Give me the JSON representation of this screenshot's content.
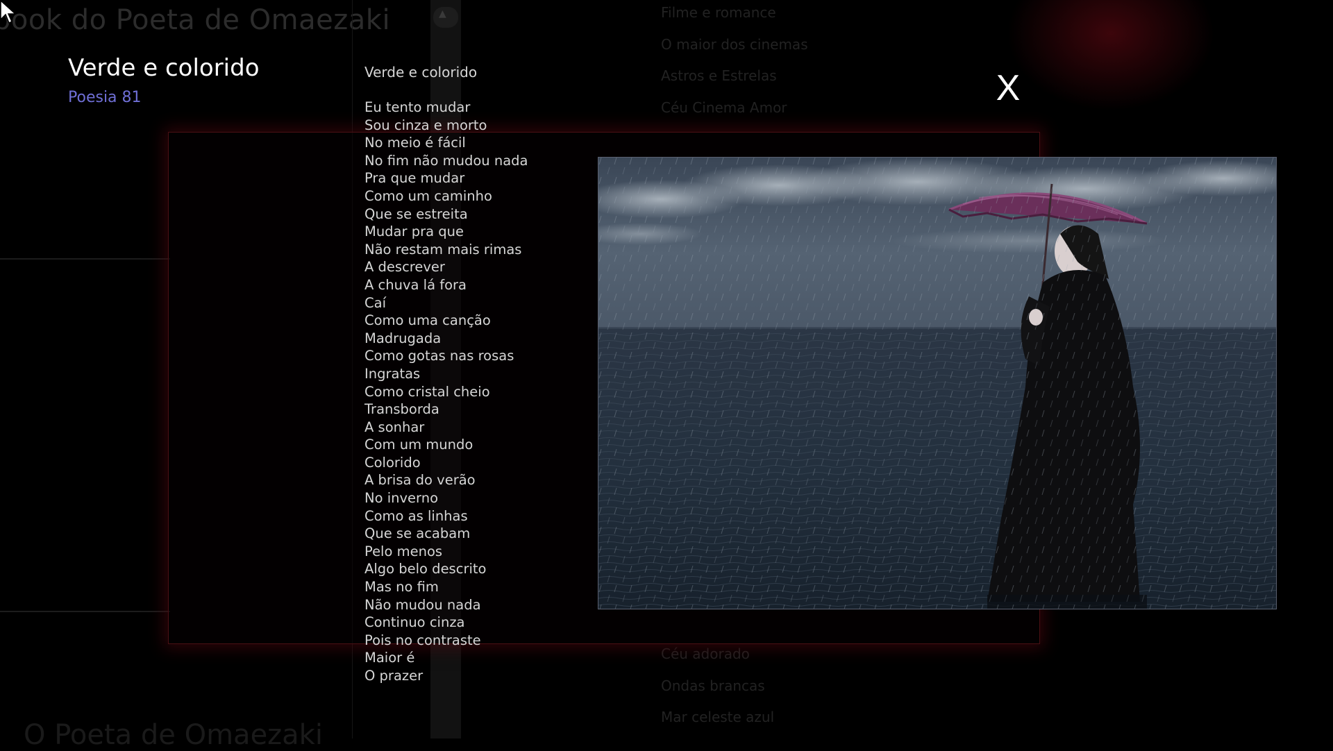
{
  "background": {
    "site_title": "book do Poeta de Omaezaki",
    "site_title_bottom": "O Poeta de Omaezaki",
    "nav_links_top": [
      "Filme e romance",
      "O maior dos cinemas",
      "Astros e Estrelas",
      "Céu Cinema Amor"
    ],
    "nav_links_bottom": [
      "Céu adorado",
      "Ondas brancas",
      "Mar celeste azul"
    ]
  },
  "modal": {
    "title": "Verde e colorido",
    "subtitle": "Poesia 81",
    "close_label": "X",
    "poem_header": "Verde e colorido",
    "poem_lines": [
      "Eu tento mudar",
      "Sou cinza e morto",
      "No meio é fácil",
      "No fim não mudou nada",
      "Pra que mudar",
      "Como um caminho",
      "Que se estreita",
      "Mudar pra que",
      "Não restam mais rimas",
      "A descrever",
      "A chuva lá fora",
      "Caí",
      "Como uma canção",
      "Madrugada",
      "Como gotas nas rosas",
      "Ingratas",
      "Como cristal cheio",
      "Transborda",
      "A sonhar",
      "Com um mundo",
      "Colorido",
      "A brisa do verão",
      "No inverno",
      "Como as linhas",
      "Que se acabam",
      "Pelo menos",
      "Algo belo descrito",
      "Mas no fim",
      "Não mudou nada",
      "Continuo cinza",
      "Pois no contraste",
      "Maior é",
      "O prazer"
    ],
    "photo_icon": "woman-with-umbrella-in-rain-photo"
  },
  "colors": {
    "background": "#000000",
    "subtitle": "#6f6fd6",
    "frame_glow": "#500810",
    "umbrella": "#6a2f5a"
  }
}
